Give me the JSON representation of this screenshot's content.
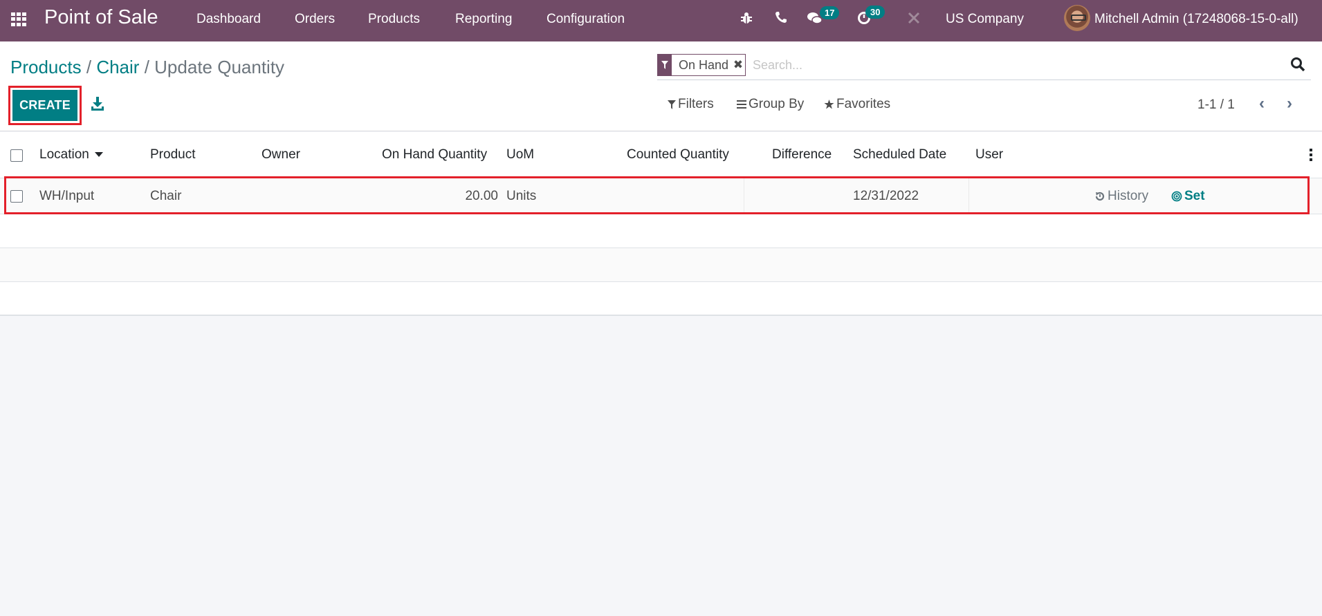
{
  "navbar": {
    "app_name": "Point of Sale",
    "menu": [
      "Dashboard",
      "Orders",
      "Products",
      "Reporting",
      "Configuration"
    ],
    "icons": [
      "debug-icon",
      "phone-icon",
      "messages-icon",
      "activity-icon",
      "tools-icon"
    ],
    "messages_count": "17",
    "activities_count": "30",
    "company": "US Company",
    "user": "Mitchell Admin (17248068-15-0-all)",
    "brand_color": "#714b67"
  },
  "breadcrumb": {
    "items": [
      "Products",
      "Chair"
    ],
    "separator": "/",
    "current": "Update Quantity"
  },
  "toolbar": {
    "create_label": "CREATE",
    "download_icon": "download-icon",
    "accent_color": "#017e84",
    "highlight_color": "#e3202a"
  },
  "search": {
    "facet_label": "On Hand",
    "placeholder": "Search...",
    "value": ""
  },
  "filters": {
    "filters_label": "Filters",
    "group_by_label": "Group By",
    "favorites_label": "Favorites"
  },
  "pager": {
    "value": "1-1 / 1"
  },
  "table": {
    "columns": [
      "Location",
      "Product",
      "Owner",
      "On Hand Quantity",
      "UoM",
      "Counted Quantity",
      "Difference",
      "Scheduled Date",
      "User"
    ],
    "sorted_column": "Location",
    "rows": [
      {
        "location": "WH/Input",
        "product": "Chair",
        "owner": "",
        "on_hand_quantity": "20.00",
        "uom": "Units",
        "counted_quantity": "",
        "difference": "",
        "scheduled_date": "12/31/2022",
        "user": "",
        "history_label": "History",
        "set_label": "Set"
      }
    ]
  }
}
